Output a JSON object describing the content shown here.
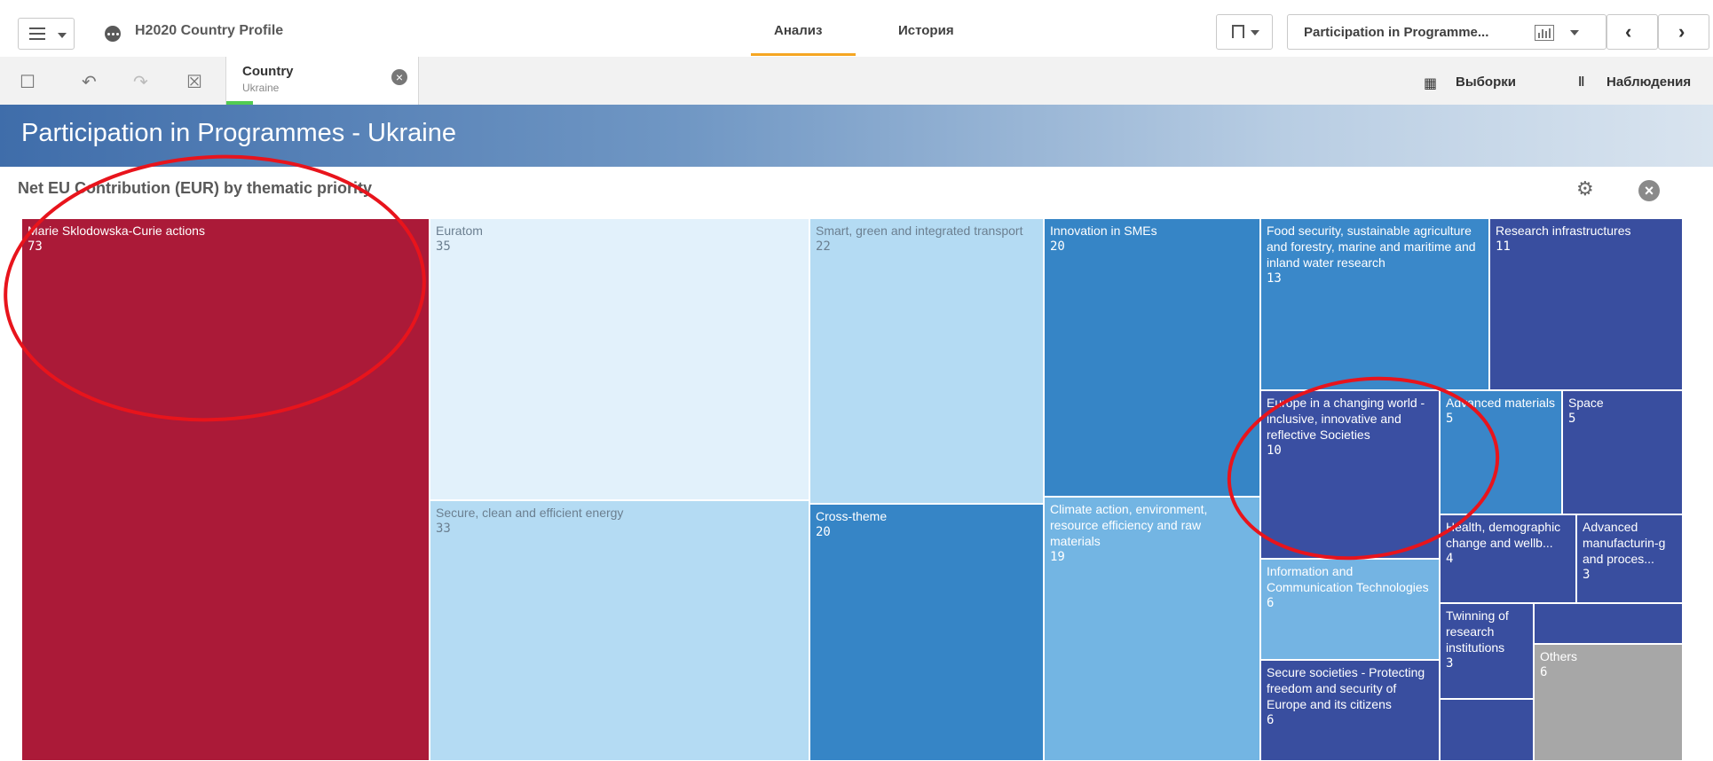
{
  "header": {
    "app_title": "H2020 Country Profile",
    "tabs": [
      "Анализ",
      "История"
    ],
    "active_tab": "Анализ",
    "sheet_selector": "Participation in Programme...",
    "accent": "#f5a623"
  },
  "selection_bar": {
    "field": "Country",
    "value": "Ukraine",
    "selections_label": "Выборки",
    "insights_label": "Наблюдения",
    "selected_color": "#52cc52"
  },
  "sheet": {
    "title": "Participation in Programmes - Ukraine"
  },
  "chart_data": {
    "type": "treemap",
    "title": "Net EU Contribution (EUR) by thematic priority",
    "items": [
      {
        "label": "Marie Sklodowska-Curie actions",
        "value": "73",
        "color": "#ab1a38"
      },
      {
        "label": "Euratom",
        "value": "35",
        "color": "#e2f1fb"
      },
      {
        "label": "Secure, clean and efficient energy",
        "value": "33",
        "color": "#b4dbf3"
      },
      {
        "label": "Smart, green and integrated transport",
        "value": "22",
        "color": "#b4dbf3"
      },
      {
        "label": "Cross-theme",
        "value": "20",
        "color": "#3685c6"
      },
      {
        "label": "Innovation in SMEs",
        "value": "20",
        "color": "#3685c6"
      },
      {
        "label": "Climate action, environment, resource efficiency and raw materials",
        "value": "19",
        "color": "#73b5e3"
      },
      {
        "label": "Food security, sustainable agriculture and forestry, marine and maritime and inland water research",
        "value": "13",
        "color": "#3a88c9"
      },
      {
        "label": "Research infrastructures",
        "value": "11",
        "color": "#394e9f"
      },
      {
        "label": "Europe in a changing world - inclusive, innovative and reflective Societies",
        "value": "10",
        "color": "#3a4fa2"
      },
      {
        "label": "Advanced materials",
        "value": "5",
        "color": "#3a86c8"
      },
      {
        "label": "Space",
        "value": "5",
        "color": "#394e9f"
      },
      {
        "label": "Information and Communication Technologies",
        "value": "6",
        "color": "#74b4e3"
      },
      {
        "label": "Secure societies - Protecting freedom and security of Europe and its citizens",
        "value": "6",
        "color": "#394e9f"
      },
      {
        "label": "Health, demographic change and wellb...",
        "value": "4",
        "color": "#394e9f"
      },
      {
        "label": "Advanced manufacturin-g and proces...",
        "value": "3",
        "color": "#394e9f"
      },
      {
        "label": "Twinning of research institutions",
        "value": "3",
        "color": "#394e9f"
      },
      {
        "label": "",
        "value": "",
        "color": "#394e9f"
      },
      {
        "label": "",
        "value": "",
        "color": "#394e9f"
      },
      {
        "label": "Others",
        "value": "6",
        "color": "#a7a7a7"
      }
    ]
  }
}
